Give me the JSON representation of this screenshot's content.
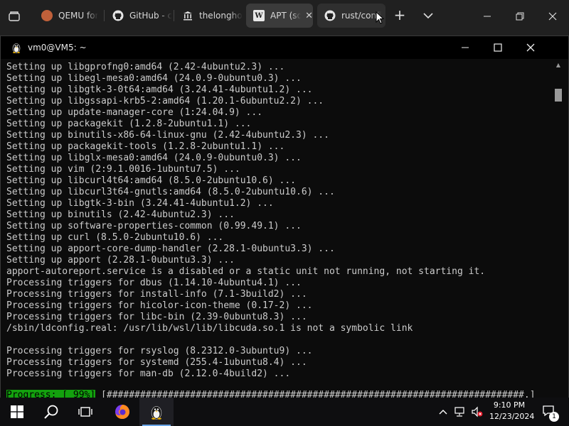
{
  "browser": {
    "tabs": [
      {
        "label": "QEMU for",
        "icon": "qemu-icon"
      },
      {
        "label": "GitHub - c",
        "icon": "github-icon"
      },
      {
        "label": "thelongho",
        "icon": "museum-icon"
      },
      {
        "label": "APT (so",
        "icon": "wikipedia-icon",
        "active": true
      },
      {
        "label": "rust/confi",
        "icon": "github-icon"
      }
    ],
    "close_glyph": "✕",
    "new_tab_glyph": "+"
  },
  "terminal": {
    "title": "vm0@VM5: ~",
    "lines": [
      "Setting up libgprofng0:amd64 (2.42-4ubuntu2.3) ...",
      "Setting up libegl-mesa0:amd64 (24.0.9-0ubuntu0.3) ...",
      "Setting up libgtk-3-0t64:amd64 (3.24.41-4ubuntu1.2) ...",
      "Setting up libgssapi-krb5-2:amd64 (1.20.1-6ubuntu2.2) ...",
      "Setting up update-manager-core (1:24.04.9) ...",
      "Setting up packagekit (1.2.8-2ubuntu1.1) ...",
      "Setting up binutils-x86-64-linux-gnu (2.42-4ubuntu2.3) ...",
      "Setting up packagekit-tools (1.2.8-2ubuntu1.1) ...",
      "Setting up libglx-mesa0:amd64 (24.0.9-0ubuntu0.3) ...",
      "Setting up vim (2:9.1.0016-1ubuntu7.5) ...",
      "Setting up libcurl4t64:amd64 (8.5.0-2ubuntu10.6) ...",
      "Setting up libcurl3t64-gnutls:amd64 (8.5.0-2ubuntu10.6) ...",
      "Setting up libgtk-3-bin (3.24.41-4ubuntu1.2) ...",
      "Setting up binutils (2.42-4ubuntu2.3) ...",
      "Setting up software-properties-common (0.99.49.1) ...",
      "Setting up curl (8.5.0-2ubuntu10.6) ...",
      "Setting up apport-core-dump-handler (2.28.1-0ubuntu3.3) ...",
      "Setting up apport (2.28.1-0ubuntu3.3) ...",
      "apport-autoreport.service is a disabled or a static unit not running, not starting it.",
      "Processing triggers for dbus (1.14.10-4ubuntu4.1) ...",
      "Processing triggers for install-info (7.1-3build2) ...",
      "Processing triggers for hicolor-icon-theme (0.17-2) ...",
      "Processing triggers for libc-bin (2.39-0ubuntu8.3) ...",
      "/sbin/ldconfig.real: /usr/lib/wsl/lib/libcuda.so.1 is not a symbolic link",
      "",
      "Processing triggers for rsyslog (8.2312.0-3ubuntu9) ...",
      "Processing triggers for systemd (255.4-1ubuntu8.4) ...",
      "Processing triggers for man-db (2.12.0-4build2) ..."
    ],
    "progress_label": "Progress: [ 99%]",
    "progress_bar": " [###########################################################################.]",
    "progress_value": 0.99
  },
  "taskbar": {
    "time": "9:10 PM",
    "date": "12/23/2024",
    "notification_count": "1",
    "accent": "#6aa6e8"
  }
}
